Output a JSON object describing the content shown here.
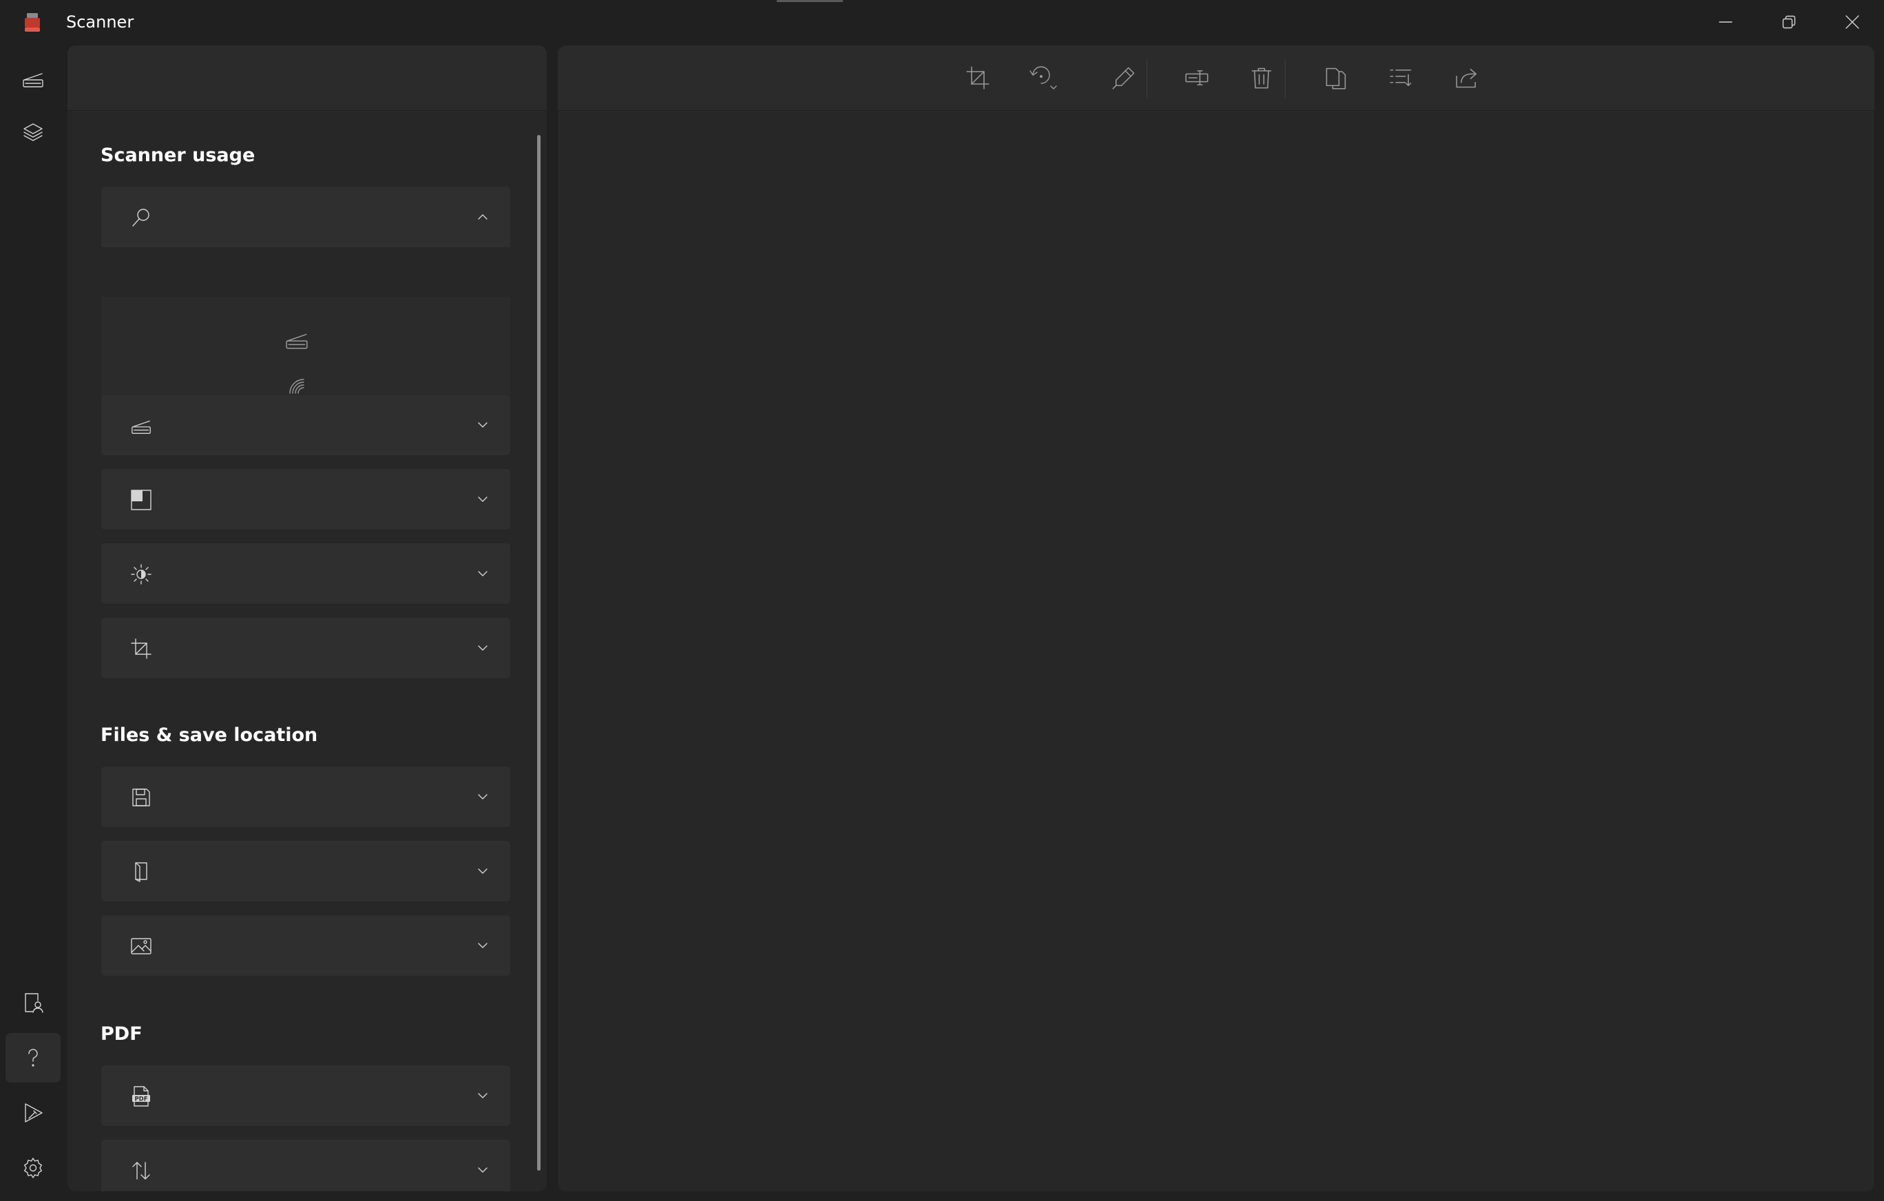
{
  "window": {
    "title": "Scanner",
    "icons": {
      "app": "scanner-app-icon",
      "minimize": "minimize-icon",
      "restore": "restore-icon",
      "close": "close-icon"
    }
  },
  "nav_rail": {
    "top_items": [
      "scanner-icon",
      "layers-icon"
    ],
    "bottom_items": [
      "contact-icon",
      "help-icon",
      "feedback-icon",
      "settings-icon"
    ],
    "selected": "help-icon"
  },
  "settings_panel": {
    "sections": {
      "scanner_usage": {
        "title": "Scanner usage",
        "items": [
          {
            "icon": "search-icon",
            "state": "expanded",
            "sub_icons": [
              "scanner-icon",
              "wireless-scanner-icon"
            ]
          },
          {
            "icon": "scanner-icon",
            "state": "collapsed"
          },
          {
            "icon": "color-mode-icon",
            "state": "collapsed"
          },
          {
            "icon": "brightness-icon",
            "state": "collapsed"
          },
          {
            "icon": "crop-icon",
            "state": "collapsed"
          }
        ]
      },
      "files": {
        "title": "Files & save location",
        "items": [
          {
            "icon": "save-icon",
            "state": "collapsed"
          },
          {
            "icon": "folder-icon",
            "state": "collapsed"
          },
          {
            "icon": "image-icon",
            "state": "collapsed"
          }
        ]
      },
      "pdf": {
        "title": "PDF",
        "items": [
          {
            "icon": "pdf-icon",
            "state": "collapsed"
          },
          {
            "icon": "sort-icon",
            "state": "collapsed"
          }
        ]
      }
    }
  },
  "toolbar": {
    "buttons": [
      "crop-icon",
      "rotate-icon",
      "edit-icon",
      "rename-icon",
      "delete-icon",
      "copy-icon",
      "list-icon",
      "share-icon"
    ],
    "enabled": false
  },
  "colors": {
    "background": "#202020",
    "panel": "#272727",
    "expander": "#2f2f2f",
    "icon": "#d4d4d4",
    "icon_disabled": "#9a9a9a",
    "app_icon": "#c4372b"
  }
}
